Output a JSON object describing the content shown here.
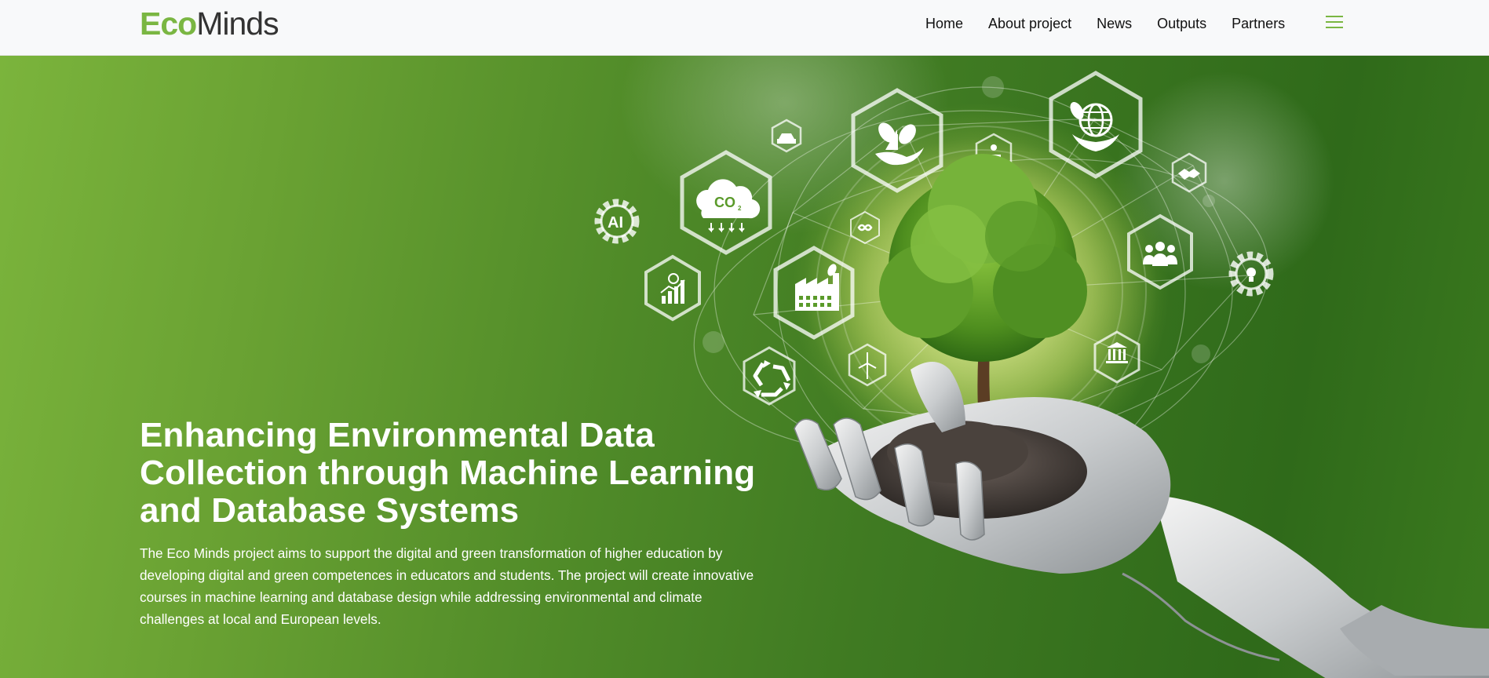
{
  "header": {
    "logo": {
      "part1": "Eco",
      "part2": "Minds"
    },
    "nav": [
      {
        "label": "Home"
      },
      {
        "label": "About project"
      },
      {
        "label": "News"
      },
      {
        "label": "Outputs"
      },
      {
        "label": "Partners"
      }
    ]
  },
  "hero": {
    "title": "Enhancing Environmental Data Collection through Machine Learning and Database Systems",
    "description": "The Eco Minds project aims to support the digital and green transformation of higher education by developing digital and green competences in educators and students. The project will create innovative courses in machine learning and database design while addressing environmental and climate challenges at local and European levels.",
    "icons": {
      "ai_label": "AI",
      "co2_label": "CO",
      "co2_sub": "2"
    }
  },
  "colors": {
    "brand_green": "#7ab642",
    "nav_text": "#111111",
    "header_bg": "#f8f9fa"
  }
}
